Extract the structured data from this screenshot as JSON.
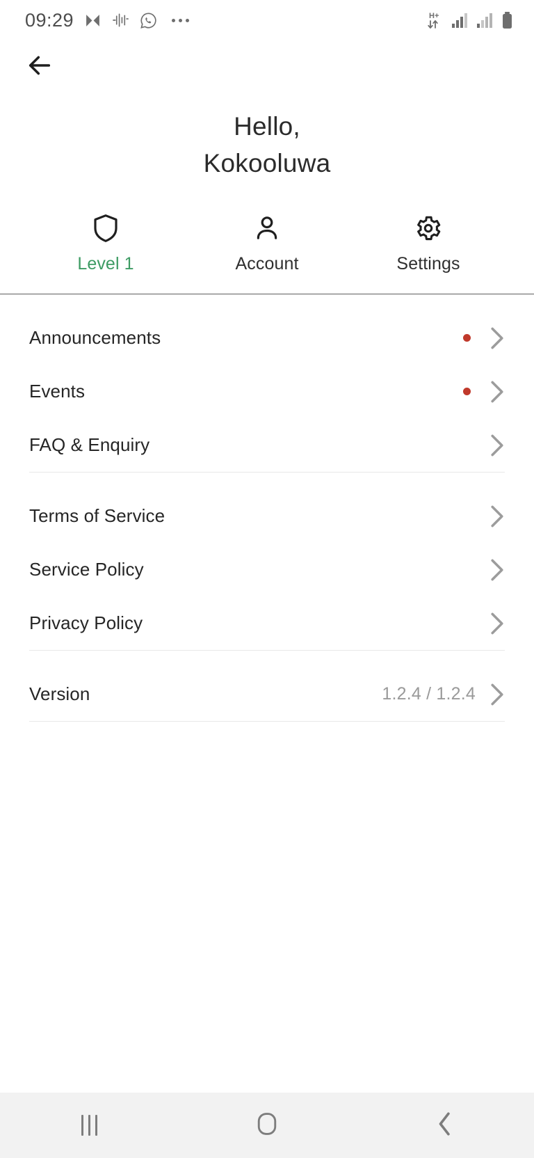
{
  "status_bar": {
    "time": "09:29",
    "left_icons": [
      "music-app-icon",
      "audio-waveform-icon",
      "whatsapp-icon",
      "more-notifications-icon"
    ],
    "right_icons": [
      "hplus-data-icon",
      "signal-bars-sim1-icon",
      "signal-bars-sim2-icon",
      "battery-icon"
    ],
    "data_network_label": "H+"
  },
  "top_bar": {
    "back_icon": "arrow-left-icon"
  },
  "header": {
    "greeting_line1": "Hello,",
    "greeting_line2": "Kokooluwa"
  },
  "tabs": [
    {
      "label": "Level 1",
      "icon": "shield-icon",
      "accent": true
    },
    {
      "label": "Account",
      "icon": "person-icon",
      "accent": false
    },
    {
      "label": "Settings",
      "icon": "gear-icon",
      "accent": false
    }
  ],
  "menu_groups": [
    {
      "items": [
        {
          "label": "Announcements",
          "badge": true,
          "value": ""
        },
        {
          "label": "Events",
          "badge": true,
          "value": ""
        },
        {
          "label": "FAQ & Enquiry",
          "badge": false,
          "value": ""
        }
      ]
    },
    {
      "items": [
        {
          "label": "Terms of Service",
          "badge": false,
          "value": ""
        },
        {
          "label": "Service Policy",
          "badge": false,
          "value": ""
        },
        {
          "label": "Privacy Policy",
          "badge": false,
          "value": ""
        }
      ]
    },
    {
      "items": [
        {
          "label": "Version",
          "badge": false,
          "value": "1.2.4 / 1.2.4"
        }
      ]
    }
  ],
  "nav_bar": {
    "recents_label": "recents-icon",
    "home_label": "home-icon",
    "back_label": "back-icon"
  },
  "colors": {
    "accent_green": "#3d9b63",
    "badge_red": "#c0392b",
    "text_primary": "#262626",
    "text_muted": "#9a9a9a",
    "divider": "#e8e8e8",
    "nav_background": "#f2f2f2"
  }
}
